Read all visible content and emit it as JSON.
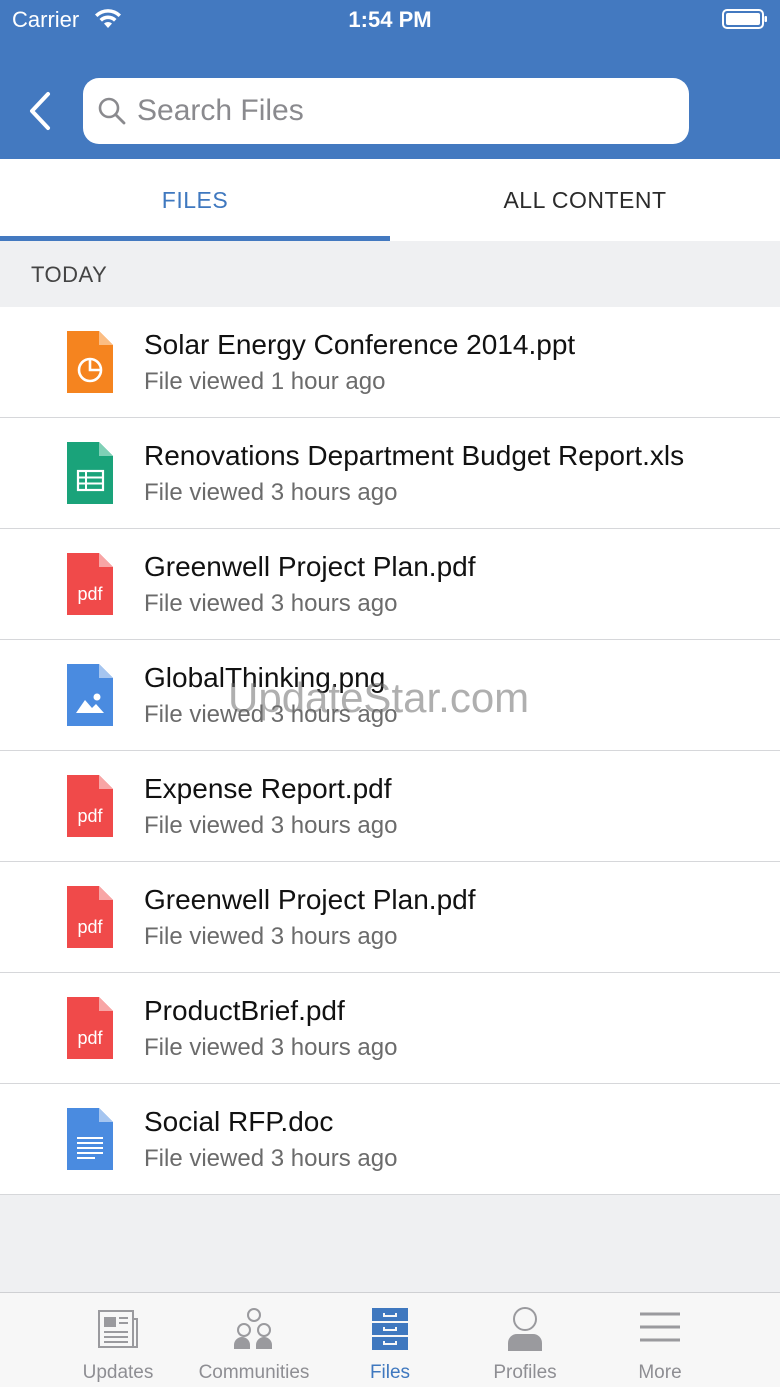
{
  "status_bar": {
    "carrier": "Carrier",
    "time": "1:54 PM"
  },
  "search": {
    "placeholder": "Search Files",
    "value": ""
  },
  "tabs": [
    {
      "label": "FILES",
      "active": true
    },
    {
      "label": "ALL CONTENT",
      "active": false
    }
  ],
  "section": {
    "title": "TODAY"
  },
  "files": [
    {
      "name": "Solar Energy Conference 2014.ppt",
      "meta": "File viewed 1 hour ago",
      "type": "presentation-file-icon"
    },
    {
      "name": "Renovations Department Budget Report.xls",
      "meta": "File viewed 3 hours ago",
      "type": "spreadsheet-file-icon"
    },
    {
      "name": "Greenwell Project Plan.pdf",
      "meta": "File viewed 3 hours ago",
      "type": "pdf-file-icon",
      "icon_label": "pdf"
    },
    {
      "name": "GlobalThinking.png",
      "meta": "File viewed 3 hours ago",
      "type": "image-file-icon"
    },
    {
      "name": "Expense Report.pdf",
      "meta": "File viewed 3 hours ago",
      "type": "pdf-file-icon",
      "icon_label": "pdf"
    },
    {
      "name": "Greenwell Project Plan.pdf",
      "meta": "File viewed 3 hours ago",
      "type": "pdf-file-icon",
      "icon_label": "pdf"
    },
    {
      "name": "ProductBrief.pdf",
      "meta": "File viewed 3 hours ago",
      "type": "pdf-file-icon",
      "icon_label": "pdf"
    },
    {
      "name": "Social RFP.doc",
      "meta": "File viewed 3 hours ago",
      "type": "document-file-icon"
    }
  ],
  "watermark": "UpdateStar.com",
  "tabbar": [
    {
      "label": "Updates",
      "icon": "newspaper-icon",
      "active": false
    },
    {
      "label": "Communities",
      "icon": "communities-icon",
      "active": false
    },
    {
      "label": "Files",
      "icon": "file-cabinet-icon",
      "active": true
    },
    {
      "label": "Profiles",
      "icon": "person-icon",
      "active": false
    },
    {
      "label": "More",
      "icon": "menu-icon",
      "active": false
    }
  ],
  "colors": {
    "header": "#4379c0",
    "accent": "#3f78bf",
    "pdf": "#f04a4a",
    "presentation": "#f5841f",
    "spreadsheet": "#1aa37a",
    "image": "#4a8be0",
    "document": "#4a8be0"
  }
}
